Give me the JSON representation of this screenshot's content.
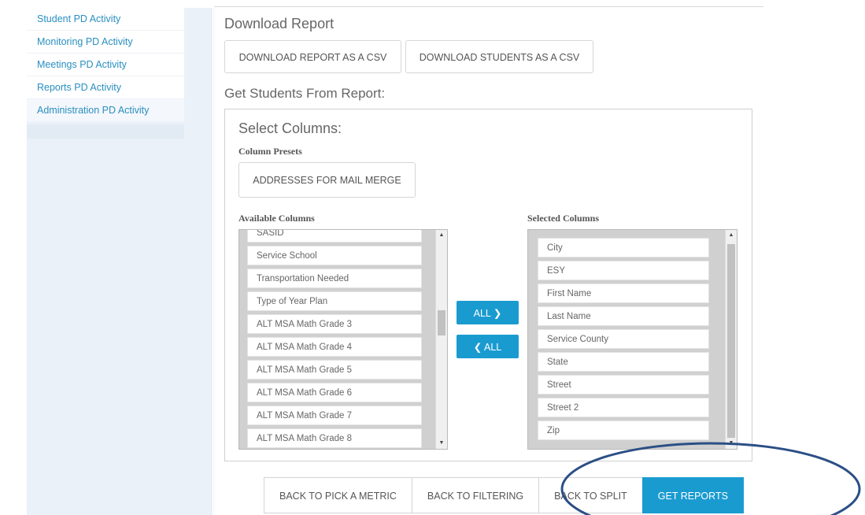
{
  "sidebar": {
    "items": [
      {
        "label": "Student PD Activity"
      },
      {
        "label": "Monitoring PD Activity"
      },
      {
        "label": "Meetings PD Activity"
      },
      {
        "label": "Reports PD Activity"
      },
      {
        "label": "Administration PD Activity"
      }
    ]
  },
  "download": {
    "title": "Download Report",
    "csv_report_label": "DOWNLOAD REPORT AS A CSV",
    "csv_students_label": "DOWNLOAD STUDENTS AS A CSV"
  },
  "get_students": {
    "title": "Get Students From Report:"
  },
  "select_columns": {
    "title": "Select Columns:",
    "presets_label": "Column Presets",
    "preset_button": "ADDRESSES FOR MAIL MERGE",
    "available_label": "Available Columns",
    "selected_label": "Selected Columns",
    "available": [
      "SASID",
      "Service School",
      "Transportation Needed",
      "Type of Year Plan",
      "ALT MSA Math Grade 3",
      "ALT MSA Math Grade 4",
      "ALT MSA Math Grade 5",
      "ALT MSA Math Grade 6",
      "ALT MSA Math Grade 7",
      "ALT MSA Math Grade 8"
    ],
    "selected": [
      "City",
      "ESY",
      "First Name",
      "Last Name",
      "Service County",
      "State",
      "Street",
      "Street 2",
      "Zip"
    ],
    "all_right_label": "ALL ❯",
    "all_left_label": "❮ ALL"
  },
  "bottom": {
    "back_metric": "BACK TO PICK A METRIC",
    "back_filtering": "BACK TO FILTERING",
    "back_split": "BACK TO SPLIT",
    "get_reports": "GET REPORTS"
  },
  "colors": {
    "accent": "#1a9bd0",
    "link": "#2a8fc0",
    "annotation": "#2b4f86"
  }
}
